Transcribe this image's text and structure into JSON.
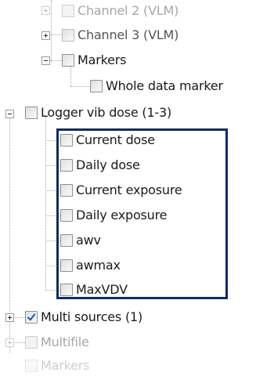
{
  "tree": {
    "items": [
      {
        "label": "Channel 2 (VLM)",
        "state": "unchecked",
        "expander": "plus"
      },
      {
        "label": "Channel 3 (VLM)",
        "state": "unchecked",
        "expander": "plus"
      },
      {
        "label": "Markers",
        "state": "unchecked",
        "expander": "minus"
      },
      {
        "label": "Whole data marker",
        "state": "unchecked"
      },
      {
        "label": "Logger vib dose (1-3)",
        "state": "unchecked",
        "expander": "minus"
      },
      {
        "label": "Current dose",
        "state": "unchecked"
      },
      {
        "label": "Daily dose",
        "state": "unchecked"
      },
      {
        "label": "Current exposure",
        "state": "unchecked"
      },
      {
        "label": "Daily exposure",
        "state": "unchecked"
      },
      {
        "label": "awv",
        "state": "unchecked"
      },
      {
        "label": "awmax",
        "state": "unchecked"
      },
      {
        "label": "MaxVDV",
        "state": "unchecked"
      },
      {
        "label": "Multi sources (1)",
        "state": "checked",
        "expander": "plus"
      },
      {
        "label": "Multifile",
        "state": "unchecked",
        "expander": "plus"
      },
      {
        "label": "Markers",
        "state": "unchecked",
        "expander": "plus"
      }
    ]
  },
  "highlight_color": "#0f2b63",
  "check_color": "#2f55c8"
}
